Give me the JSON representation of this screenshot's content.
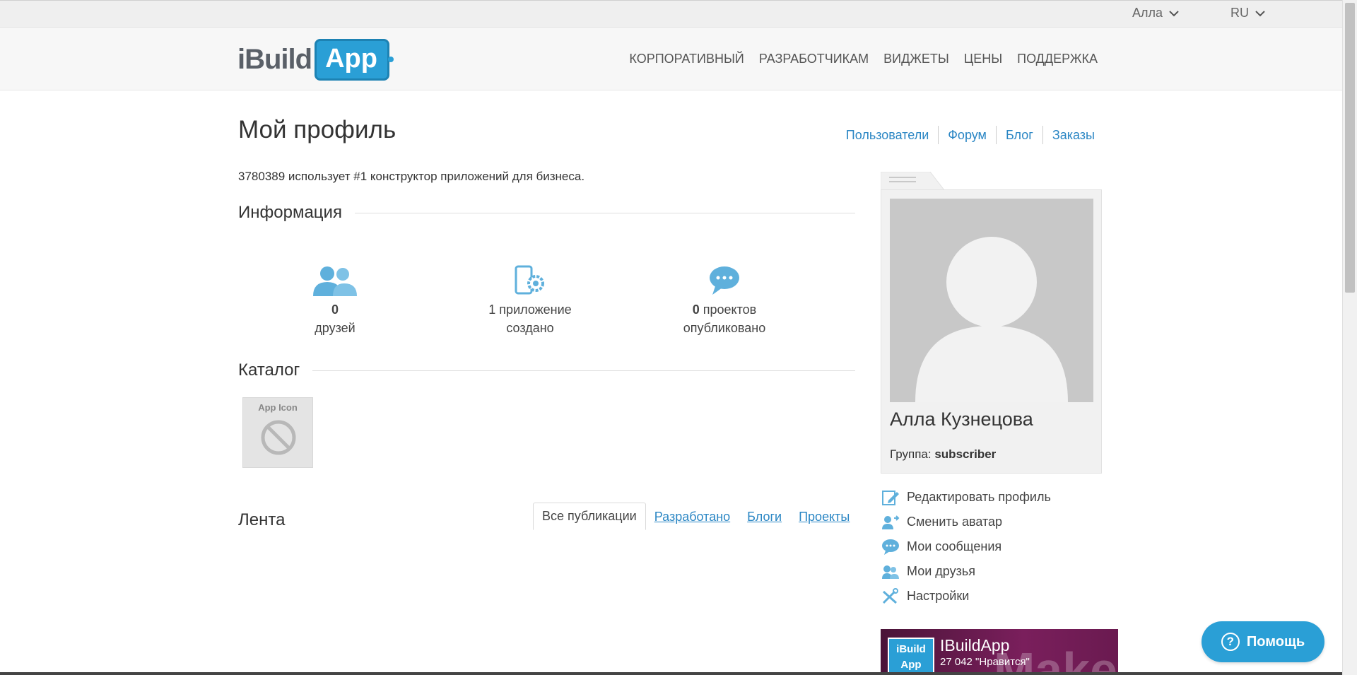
{
  "topbar": {
    "user_menu": "Алла",
    "language": "RU"
  },
  "header": {
    "logo_text_1": "iBuild",
    "logo_text_2": "App",
    "nav": [
      "КОРПОРАТИВНЫЙ",
      "РАЗРАБОТЧИКАМ",
      "ВИДЖЕТЫ",
      "ЦЕНЫ",
      "ПОДДЕРЖКА"
    ]
  },
  "page": {
    "title": "Мой профиль",
    "subnav": [
      "Пользователи",
      "Форум",
      "Блог",
      "Заказы"
    ],
    "tagline": "3780389 использует #1 конструктор приложений для бизнеса."
  },
  "info": {
    "heading": "Информация",
    "friends_count": "0",
    "friends_label": "друзей",
    "apps_line1": "1 приложение",
    "apps_line2": "создано",
    "projects_count": "0",
    "projects_label1": "проектов",
    "projects_label2": "опубликовано"
  },
  "catalog": {
    "heading": "Каталог",
    "app_icon_label": "App Icon"
  },
  "feed": {
    "heading": "Лента",
    "tabs": [
      "Все публикации",
      "Разработано",
      "Блоги",
      "Проекты"
    ]
  },
  "profile": {
    "name": "Алла Кузнецова",
    "group_label": "Группа:",
    "group_value": "subscriber",
    "actions": [
      "Редактировать профиль",
      "Сменить аватар",
      "Мои сообщения",
      "Мои друзья",
      "Настройки"
    ]
  },
  "widget": {
    "thumb_line1": "iBuild",
    "thumb_line2": "App",
    "title": "IBuildApp",
    "likes": "27 042 \"Нравится\"",
    "bg_text": "Make"
  },
  "help": {
    "label": "Помощь"
  },
  "colors": {
    "accent": "#2a9fd6",
    "link": "#2a86c4"
  }
}
